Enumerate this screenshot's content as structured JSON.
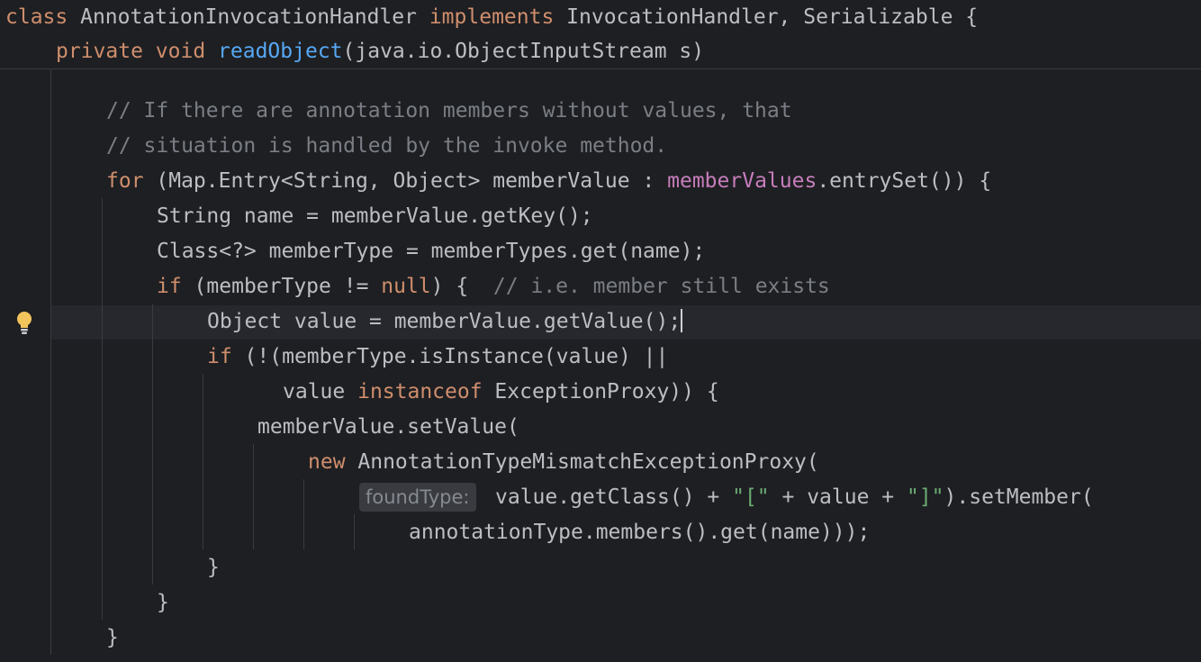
{
  "sticky_header": {
    "line1": {
      "kw_class": "class",
      "class_name": " AnnotationInvocationHandler ",
      "kw_implements": "implements",
      "interfaces": " InvocationHandler, Serializable {"
    },
    "line2": {
      "kw_private": "private",
      "kw_void": "void",
      "method_name": "readObject",
      "params": "(java.io.ObjectInputStream s)"
    }
  },
  "code": {
    "comment1": "// If there are annotation members without values, that",
    "comment2": "// situation is handled by the invoke method.",
    "for_kw": "for",
    "for_text_a": " (Map.Entry<String, Object> memberValue : ",
    "for_field": "memberValues",
    "for_text_b": ".entrySet()) {",
    "name_line": "String name = memberValue.getKey();",
    "membertype_line": "Class<?> memberType = memberTypes.get(name);",
    "if_kw": "if",
    "if_text_a": " (memberType != ",
    "null_kw": "null",
    "if_text_b": ") {  ",
    "if_comment": "// i.e. member still exists",
    "value_line": "Object value = memberValue.getValue();",
    "if2_kw": "if",
    "if2_text": " (!(memberType.isInstance(value) ||",
    "inst_text_a": "value ",
    "instanceof_kw": "instanceof",
    "inst_text_b": " ExceptionProxy)) {",
    "setvalue_line": "memberValue.setValue(",
    "new_kw": "new",
    "new_text": " AnnotationTypeMismatchExceptionProxy(",
    "hint_label": "foundType:",
    "getclass_a": "value.getClass() + ",
    "str_open": "\"[\"",
    "getclass_b": " + value + ",
    "str_close": "\"]\"",
    "getclass_c": ").setMember(",
    "members_line": "annotationType.members().get(name)));",
    "close_brace_1": "}",
    "close_brace_2": "}",
    "close_brace_3": "}"
  },
  "icons": {
    "intention": "lightbulb-icon"
  },
  "colors": {
    "background": "#1e1f22",
    "keyword": "#cf8e6d",
    "method": "#56a8f5",
    "field": "#c77dbb",
    "string": "#6aab73",
    "comment": "#7a7e85",
    "text": "#bcbec4",
    "intention_bulb": "#f2c55c"
  }
}
